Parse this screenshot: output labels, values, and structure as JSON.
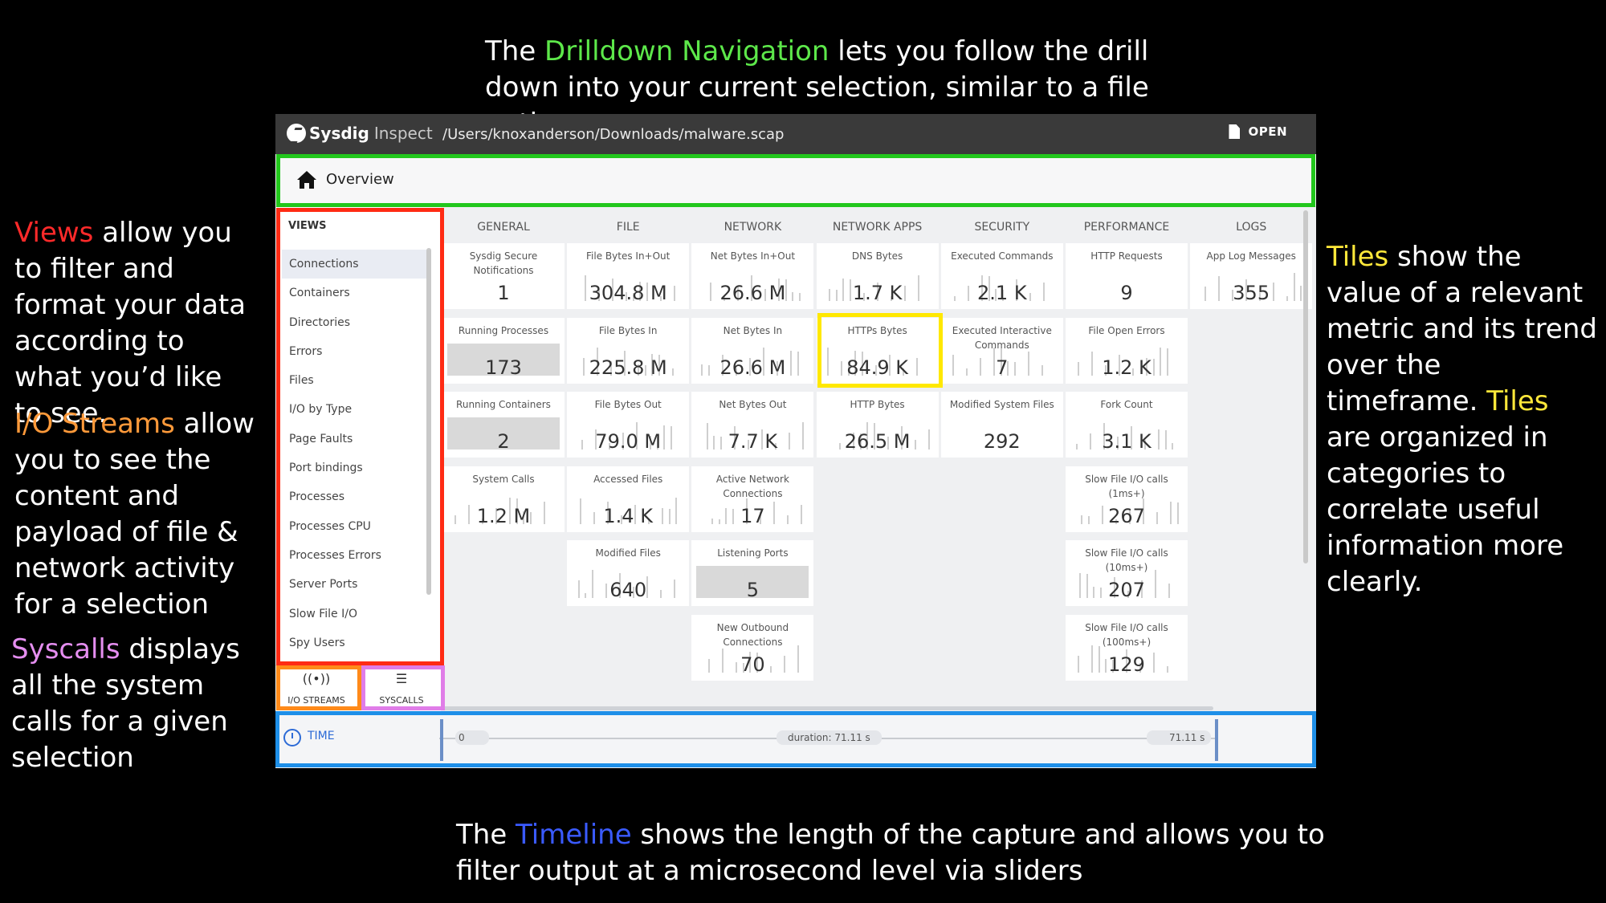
{
  "annotations": {
    "top": {
      "pre": "The ",
      "hl": "Drilldown Navigation",
      "post": " lets you follow the drill down into your current selection, similar to a file path.",
      "color": "#5de84a"
    },
    "views": {
      "hl": "Views",
      "post": " allow you to filter and format your data according to what you’d like to see.",
      "color": "#ff2a2a"
    },
    "io": {
      "hl": "I/O Streams",
      "post": " allow you to see the content and payload of file & network activity for a selection",
      "color": "#ff9a3a"
    },
    "syscalls": {
      "hl": "Syscalls",
      "post": " displays all the system calls for a given selection",
      "color": "#e58ef0"
    },
    "tiles": {
      "hl": "Tiles",
      "mid": " show the value of a relevant metric and its trend over the timeframe. ",
      "hl2": "Tiles",
      "post": " are organized in categories to correlate useful information more clearly.",
      "color": "#ffe83a"
    },
    "bottom": {
      "pre": "The ",
      "hl": "Timeline",
      "post": " shows the length of the capture and allows you to filter output at a microsecond level via sliders",
      "color": "#3a5aff"
    }
  },
  "app": {
    "brand": "Sysdig",
    "product": "Inspect",
    "file_path": "/Users/knoxanderson/Downloads/malware.scap",
    "open_label": "OPEN"
  },
  "drilldown": {
    "crumb": "Overview"
  },
  "sidebar": {
    "title": "VIEWS",
    "items": [
      "Connections",
      "Containers",
      "Directories",
      "Errors",
      "Files",
      "I/O by Type",
      "Page Faults",
      "Port bindings",
      "Processes",
      "Processes CPU",
      "Processes Errors",
      "Server Ports",
      "Slow File I/O",
      "Spy Users"
    ]
  },
  "tabs": {
    "io": "I/O STREAMS",
    "syscalls": "SYSCALLS"
  },
  "categories": [
    "GENERAL",
    "FILE",
    "NETWORK",
    "NETWORK APPS",
    "SECURITY",
    "PERFORMANCE",
    "LOGS"
  ],
  "tiles": [
    [
      {
        "label": "Sysdig Secure Notifications",
        "value": "1"
      },
      {
        "label": "Running Processes",
        "value": "173",
        "spark": "fill"
      },
      {
        "label": "Running Containers",
        "value": "2",
        "spark": "fill"
      },
      {
        "label": "System Calls",
        "value": "1.2 M",
        "spark": "bars"
      }
    ],
    [
      {
        "label": "File Bytes In+Out",
        "value": "304.8 M",
        "spark": "bars"
      },
      {
        "label": "File Bytes In",
        "value": "225.8 M",
        "spark": "bars"
      },
      {
        "label": "File Bytes Out",
        "value": "79.0 M",
        "spark": "bars"
      },
      {
        "label": "Accessed Files",
        "value": "1.4 K",
        "spark": "bars"
      },
      {
        "label": "Modified Files",
        "value": "640",
        "spark": "bars"
      }
    ],
    [
      {
        "label": "Net Bytes In+Out",
        "value": "26.6 M",
        "spark": "bars"
      },
      {
        "label": "Net Bytes In",
        "value": "26.6 M",
        "spark": "bars"
      },
      {
        "label": "Net Bytes Out",
        "value": "7.7 K",
        "spark": "bars"
      },
      {
        "label": "Active Network Connections",
        "value": "17",
        "spark": "bars"
      },
      {
        "label": "Listening Ports",
        "value": "5",
        "spark": "fill"
      },
      {
        "label": "New Outbound Connections",
        "value": "70",
        "spark": "bars"
      }
    ],
    [
      {
        "label": "DNS Bytes",
        "value": "1.7 K",
        "spark": "bars"
      },
      {
        "label": "HTTPs Bytes",
        "value": "84.9 K",
        "spark": "bars"
      },
      {
        "label": "HTTP Bytes",
        "value": "26.5 M",
        "spark": "bars"
      }
    ],
    [
      {
        "label": "Executed Commands",
        "value": "2.1 K",
        "spark": "bars"
      },
      {
        "label": "Executed Interactive Commands",
        "value": "7",
        "spark": "bars"
      },
      {
        "label": "Modified System Files",
        "value": "292"
      }
    ],
    [
      {
        "label": "HTTP Requests",
        "value": "9"
      },
      {
        "label": "File Open Errors",
        "value": "1.2 K",
        "spark": "bars"
      },
      {
        "label": "Fork Count",
        "value": "3.1 K",
        "spark": "bars"
      },
      {
        "label": "Slow File I/O calls (1ms+)",
        "value": "267",
        "spark": "bars"
      },
      {
        "label": "Slow File I/O calls (10ms+)",
        "value": "207",
        "spark": "bars"
      },
      {
        "label": "Slow File I/O calls (100ms+)",
        "value": "129",
        "spark": "bars"
      }
    ],
    [
      {
        "label": "App Log Messages",
        "value": "355",
        "spark": "bars"
      }
    ]
  ],
  "timeline": {
    "label": "TIME",
    "start": "0",
    "duration": "duration: 71.11 s",
    "end": "71.11 s"
  },
  "colors": {
    "titlebar": "#3a3a3a",
    "accent": "#2d6bd6",
    "drilldown_box": "#22c71c",
    "views_box": "#ff2b14",
    "io_box": "#ff8a19",
    "syscalls_box": "#e07de8",
    "tile_box": "#ffe800",
    "timeline_box": "#1e8fe8"
  }
}
